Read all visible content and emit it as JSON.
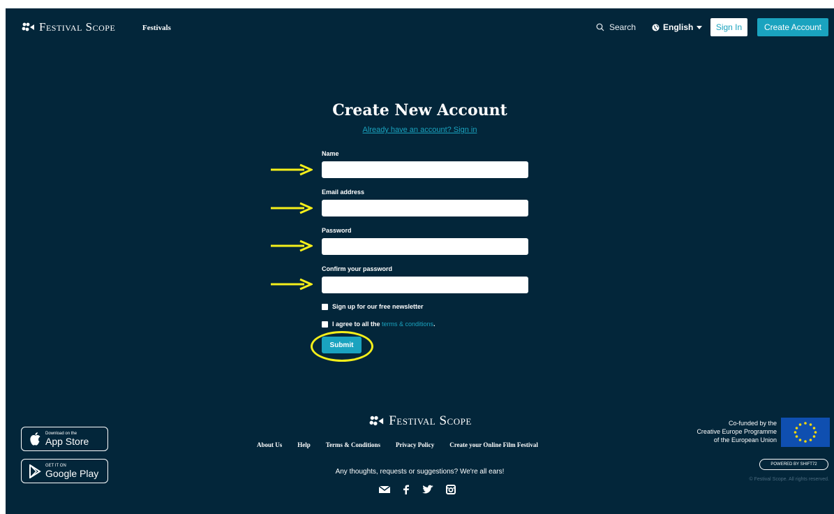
{
  "header": {
    "brand": "Festival Scope",
    "nav_festivals": "Festivals",
    "search_label": "Search",
    "language": "English",
    "signin_label": "Sign In",
    "create_account_label": "Create Account"
  },
  "form": {
    "title": "Create New Account",
    "signin_link": "Already have an account? Sign in",
    "fields": [
      {
        "label": "Name",
        "value": ""
      },
      {
        "label": "Email address",
        "value": ""
      },
      {
        "label": "Password",
        "value": ""
      },
      {
        "label": "Confirm your password",
        "value": ""
      }
    ],
    "newsletter_label": "Sign up for our free newsletter",
    "agree_prefix": "I agree to all the ",
    "terms_link": "terms & conditions",
    "agree_suffix": ".",
    "submit_label": "Submit"
  },
  "footer": {
    "brand": "Festival Scope",
    "links": [
      "About Us",
      "Help",
      "Terms & Conditions",
      "Privacy Policy",
      "Create your Online Film Festival"
    ],
    "message": "Any thoughts, requests or suggestions? We're all ears!",
    "app_store": {
      "small": "Download on the",
      "big": "App Store"
    },
    "google_play": {
      "small": "GET IT ON",
      "big": "Google Play"
    },
    "eu_lines": [
      "Co-funded by the",
      "Creative Europe Programme",
      "of the European Union"
    ],
    "powered": "POWERED BY SHIFT72",
    "copyright": "© Festival Scope. All rights reserved."
  },
  "annotations": {
    "arrow_color": "#f5ef1a",
    "circle_color": "#f5ef1a"
  },
  "colors": {
    "background": "#03263a",
    "accent": "#1aa3bf"
  }
}
